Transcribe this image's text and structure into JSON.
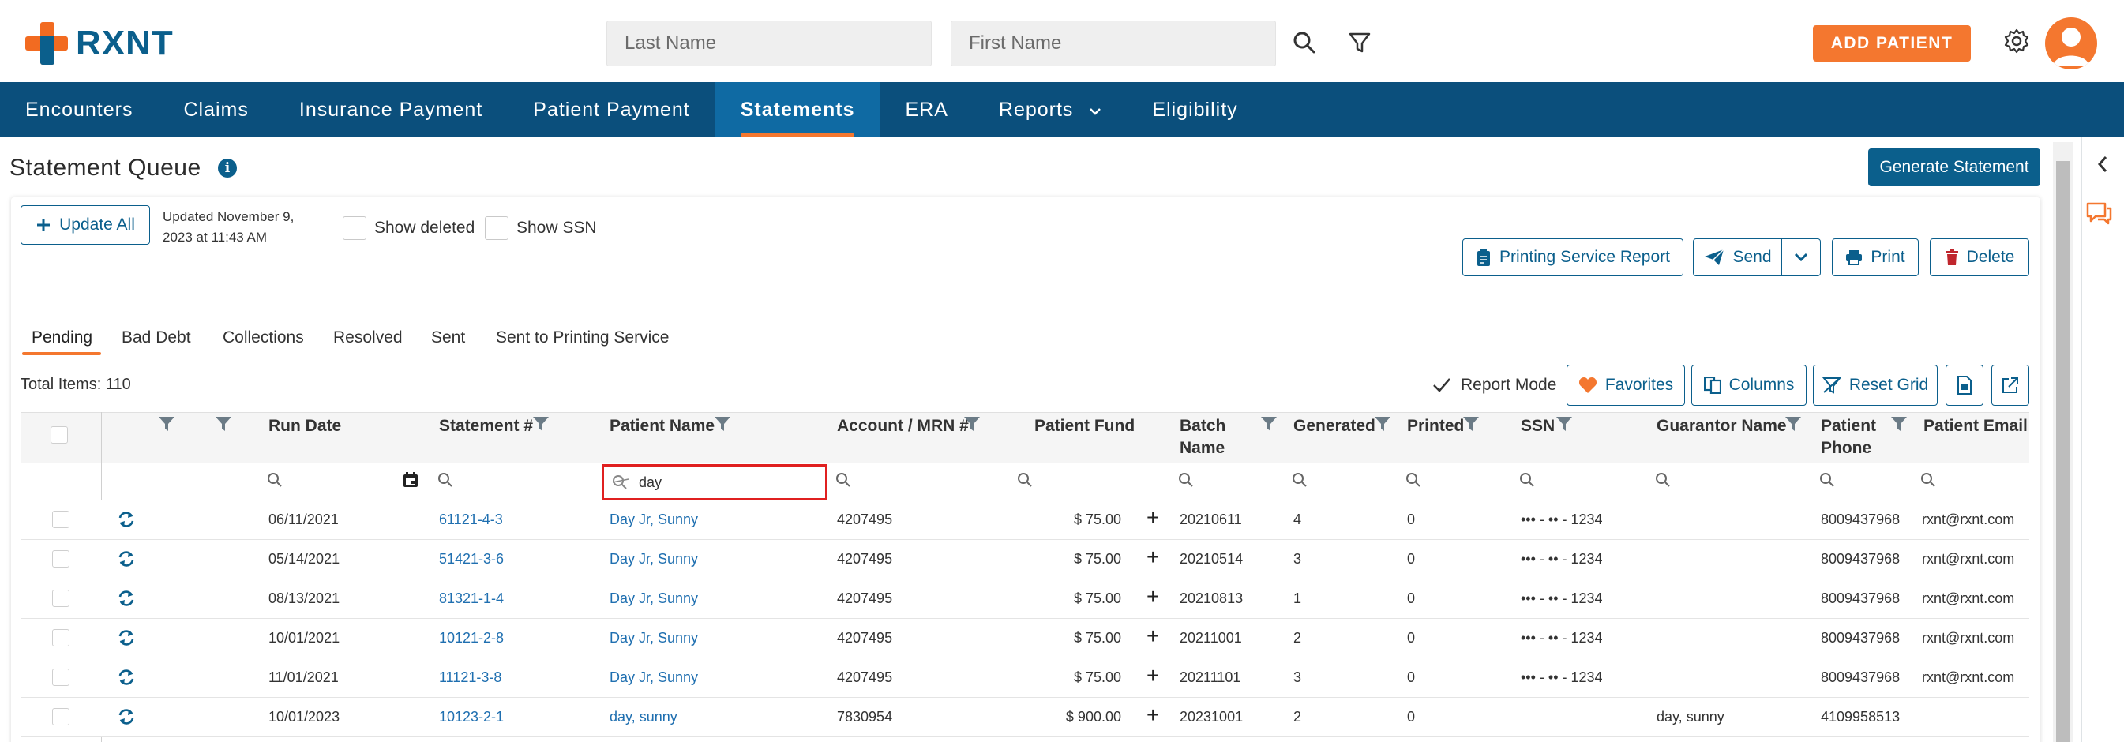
{
  "header": {
    "logo_text": "RXNT",
    "last_name_placeholder": "Last Name",
    "first_name_placeholder": "First Name",
    "add_patient_label": "ADD PATIENT"
  },
  "nav": {
    "items": [
      "Encounters",
      "Claims",
      "Insurance Payment",
      "Patient Payment",
      "Statements",
      "ERA",
      "Reports",
      "Eligibility"
    ],
    "active": "Statements"
  },
  "page": {
    "title": "Statement Queue",
    "generate_label": "Generate Statement",
    "update_all_label": "Update All",
    "updated_line1": "Updated November 9,",
    "updated_line2": "2023 at 11:43 AM",
    "show_deleted_label": "Show deleted",
    "show_ssn_label": "Show SSN",
    "printing_report_label": "Printing Service Report",
    "send_label": "Send",
    "print_label": "Print",
    "delete_label": "Delete",
    "total_items": "Total Items: 110",
    "report_mode_label": "Report Mode",
    "favorites_label": "Favorites",
    "columns_label": "Columns",
    "reset_grid_label": "Reset Grid"
  },
  "tabs": [
    "Pending",
    "Bad Debt",
    "Collections",
    "Resolved",
    "Sent",
    "Sent to Printing Service"
  ],
  "active_tab": "Pending",
  "columns": {
    "run_date": "Run Date",
    "statement": "Statement #",
    "patient_name": "Patient Name",
    "account": "Account / MRN #",
    "patient_fund": "Patient Fund",
    "batch_name": "Batch Name",
    "generated": "Generated",
    "printed": "Printed",
    "ssn": "SSN",
    "guarantor": "Guarantor Name",
    "patient_phone": "Patient Phone",
    "patient_email": "Patient Email"
  },
  "patient_name_filter": "day",
  "rows": [
    {
      "run_date": "06/11/2021",
      "statement": "61121-4-3",
      "patient": "Day Jr, Sunny",
      "account": "4207495",
      "fund": "$ 75.00",
      "batch": "20210611",
      "generated": "4",
      "printed": "0",
      "ssn": "••• - •• - 1234",
      "guarantor": "",
      "phone": "8009437968",
      "email": "rxnt@rxnt.com"
    },
    {
      "run_date": "05/14/2021",
      "statement": "51421-3-6",
      "patient": "Day Jr, Sunny",
      "account": "4207495",
      "fund": "$ 75.00",
      "batch": "20210514",
      "generated": "3",
      "printed": "0",
      "ssn": "••• - •• - 1234",
      "guarantor": "",
      "phone": "8009437968",
      "email": "rxnt@rxnt.com"
    },
    {
      "run_date": "08/13/2021",
      "statement": "81321-1-4",
      "patient": "Day Jr, Sunny",
      "account": "4207495",
      "fund": "$ 75.00",
      "batch": "20210813",
      "generated": "1",
      "printed": "0",
      "ssn": "••• - •• - 1234",
      "guarantor": "",
      "phone": "8009437968",
      "email": "rxnt@rxnt.com"
    },
    {
      "run_date": "10/01/2021",
      "statement": "10121-2-8",
      "patient": "Day Jr, Sunny",
      "account": "4207495",
      "fund": "$ 75.00",
      "batch": "20211001",
      "generated": "2",
      "printed": "0",
      "ssn": "••• - •• - 1234",
      "guarantor": "",
      "phone": "8009437968",
      "email": "rxnt@rxnt.com"
    },
    {
      "run_date": "11/01/2021",
      "statement": "11121-3-8",
      "patient": "Day Jr, Sunny",
      "account": "4207495",
      "fund": "$ 75.00",
      "batch": "20211101",
      "generated": "3",
      "printed": "0",
      "ssn": "••• - •• - 1234",
      "guarantor": "",
      "phone": "8009437968",
      "email": "rxnt@rxnt.com"
    },
    {
      "run_date": "10/01/2023",
      "statement": "10123-2-1",
      "patient": "day, sunny",
      "account": "7830954",
      "fund": "$ 900.00",
      "batch": "20231001",
      "generated": "2",
      "printed": "0",
      "ssn": "",
      "guarantor": "day, sunny",
      "phone": "4109958513",
      "email": ""
    }
  ],
  "colors": {
    "brand_blue": "#0b5f8c",
    "brand_orange": "#f4772f",
    "highlight_red": "#e02020"
  }
}
